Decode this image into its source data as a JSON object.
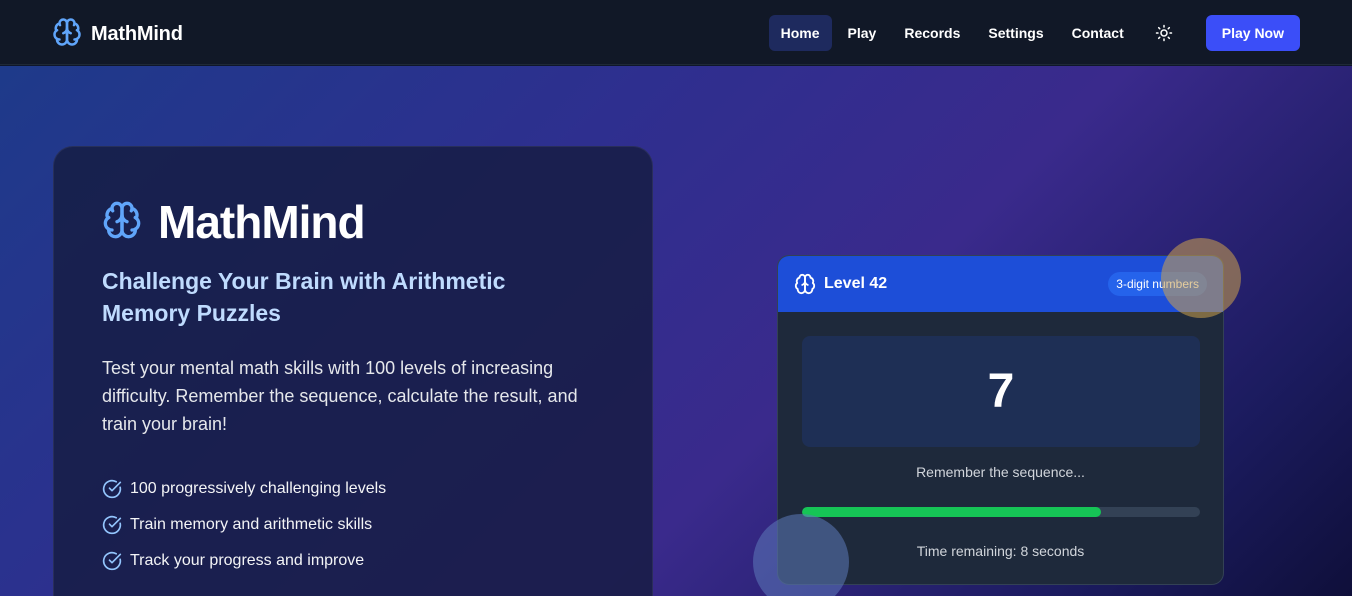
{
  "nav": {
    "brand": "MathMind",
    "links": [
      "Home",
      "Play",
      "Records",
      "Settings",
      "Contact"
    ],
    "active_link": "Home",
    "theme_icon": "sun-icon",
    "cta": "Play Now"
  },
  "hero": {
    "title": "MathMind",
    "subtitle": "Challenge Your Brain with Arithmetic Memory Puzzles",
    "description": "Test your mental math skills with 100 levels of increasing difficulty. Remember the sequence, calculate the result, and train your brain!",
    "features": [
      "100 progressively challenging levels",
      "Train memory and arithmetic skills",
      "Track your progress and improve"
    ]
  },
  "game": {
    "level": "Level 42",
    "badge": "3-digit numbers",
    "number": "7",
    "instruction": "Remember the sequence...",
    "progress": 0.75,
    "timer": "Time remaining: 8 seconds"
  },
  "colors": {
    "nav_bg": "#111827",
    "accent": "#3b4ef8",
    "brand_icon": "#60a5fa",
    "header_blue": "#1d4ed8",
    "progress_green": "#16c456"
  }
}
